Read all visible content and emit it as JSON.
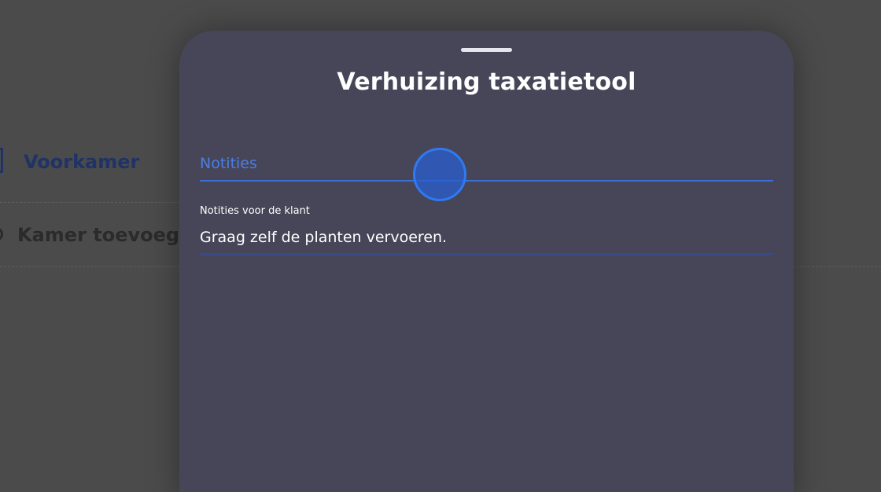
{
  "background": {
    "room_label": "Voorkamer",
    "add_room_label": "Kamer toevoegen"
  },
  "sheet": {
    "title": "Verhuizing taxatietool",
    "tab_label": "Notities",
    "notes_field": {
      "label": "Notities voor de klant",
      "value": "Graag zelf de planten vervoeren."
    }
  },
  "colors": {
    "sheet_background": "#474558",
    "accent_blue": "#3b6fd6",
    "overlay": "#4b4b4b"
  }
}
